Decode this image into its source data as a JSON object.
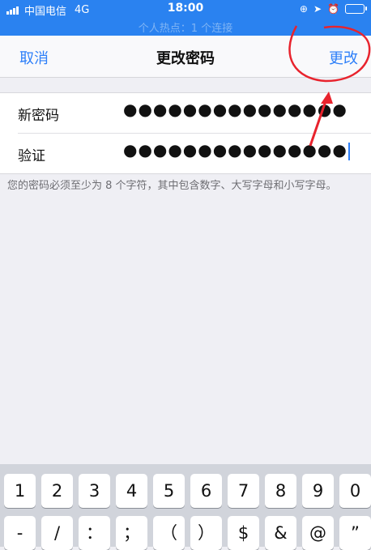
{
  "status_bar": {
    "carrier": "中国电信",
    "network": "4G",
    "time": "18:00",
    "hotspot": "个人热点：1 个连接"
  },
  "nav": {
    "cancel_label": "取消",
    "title": "更改密码",
    "change_label": "更改"
  },
  "form": {
    "new_password_label": "新密码",
    "new_password_value": "●●●●●●●●●●●●●●●",
    "verify_label": "验证",
    "verify_value": "●●●●●●●●●●●●●●●"
  },
  "hint": "您的密码必须至少为 8 个字符，其中包含数字、大写字母和小写字母。",
  "keyboard": {
    "row1": [
      "1",
      "2",
      "3",
      "4",
      "5",
      "6",
      "7",
      "8",
      "9",
      "0"
    ],
    "row2": [
      "-",
      "/",
      "：",
      "；",
      "（",
      "）",
      "$",
      "&",
      "@",
      "”"
    ]
  },
  "colors": {
    "status_bar_bg": "#2a82f0",
    "accent": "#2d7ff9",
    "annotation": "#e8232d"
  },
  "icons": [
    "signal-icon",
    "location-icon",
    "alarm-icon",
    "battery-icon",
    "orientation-lock-icon"
  ]
}
